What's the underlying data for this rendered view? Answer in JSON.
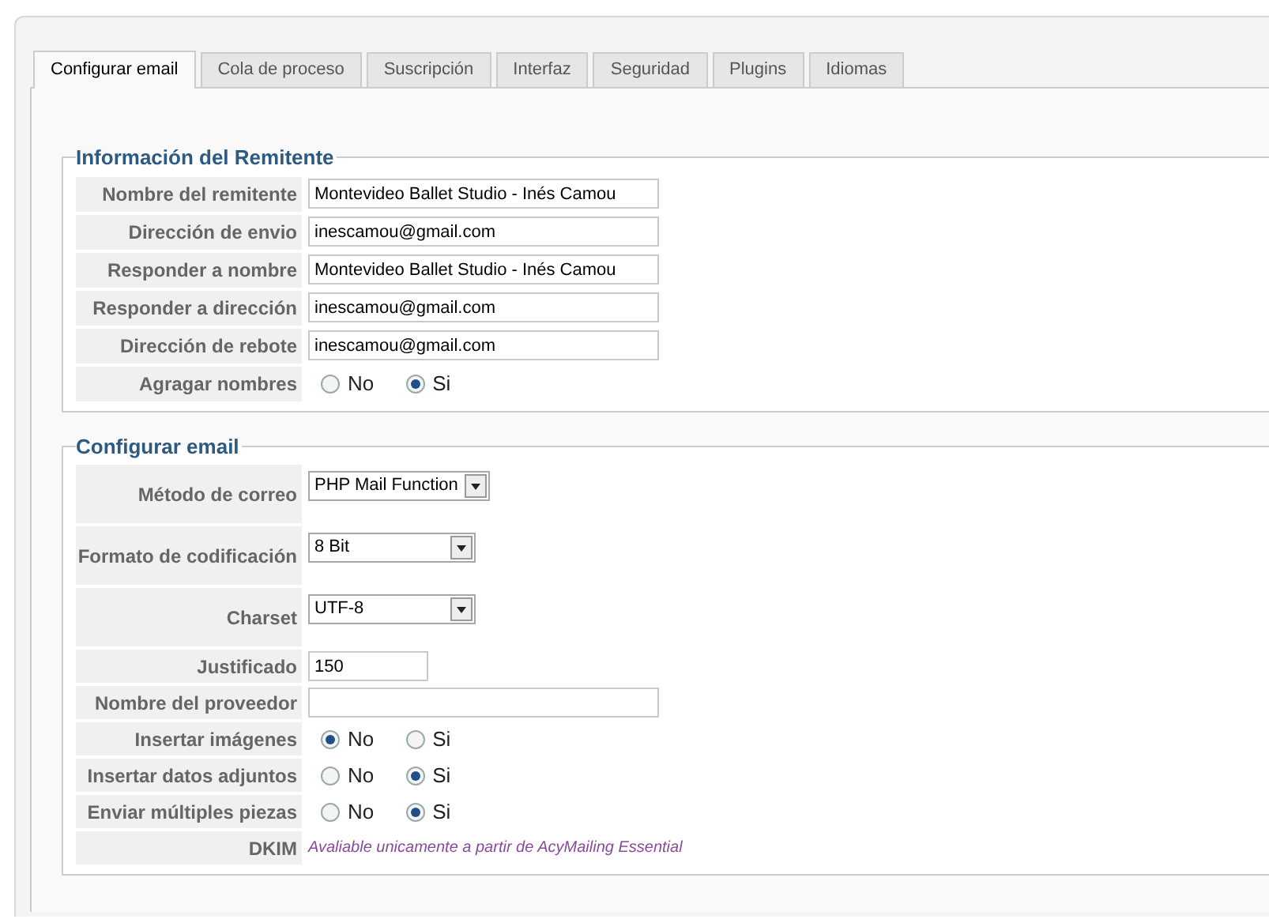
{
  "tabs": [
    {
      "label": "Configurar email",
      "selected": true
    },
    {
      "label": "Cola de proceso",
      "selected": false
    },
    {
      "label": "Suscripción",
      "selected": false
    },
    {
      "label": "Interfaz",
      "selected": false
    },
    {
      "label": "Seguridad",
      "selected": false
    },
    {
      "label": "Plugins",
      "selected": false
    },
    {
      "label": "Idiomas",
      "selected": false
    }
  ],
  "sections": [
    {
      "legend": "Información del Remitente",
      "rows": [
        {
          "kind": "text",
          "label": "Nombre del remitente",
          "value": "Montevideo Ballet Studio - Inés Camou"
        },
        {
          "kind": "text",
          "label": "Dirección de envio",
          "value": "inescamou@gmail.com"
        },
        {
          "kind": "text",
          "label": "Responder a nombre",
          "value": "Montevideo Ballet Studio - Inés Camou"
        },
        {
          "kind": "text",
          "label": "Responder a dirección",
          "value": "inescamou@gmail.com"
        },
        {
          "kind": "text",
          "label": "Dirección de rebote",
          "value": "inescamou@gmail.com"
        },
        {
          "kind": "radio",
          "label": "Agragar nombres",
          "options": [
            {
              "label": "No",
              "selected": false
            },
            {
              "label": "Si",
              "selected": true
            }
          ]
        }
      ]
    },
    {
      "legend": "Configurar email",
      "rows": [
        {
          "kind": "select",
          "label": "Método de correo",
          "value": "PHP Mail Function"
        },
        {
          "kind": "select",
          "label": "Formato de codificación",
          "value": "8 Bit"
        },
        {
          "kind": "select",
          "label": "Charset",
          "value": "UTF-8"
        },
        {
          "kind": "short",
          "label": "Justificado",
          "value": "150"
        },
        {
          "kind": "text",
          "label": "Nombre del proveedor",
          "value": ""
        },
        {
          "kind": "radio",
          "label": "Insertar imágenes",
          "options": [
            {
              "label": "No",
              "selected": true
            },
            {
              "label": "Si",
              "selected": false
            }
          ]
        },
        {
          "kind": "radio",
          "label": "Insertar datos adjuntos",
          "options": [
            {
              "label": "No",
              "selected": false
            },
            {
              "label": "Si",
              "selected": true
            }
          ]
        },
        {
          "kind": "radio",
          "label": "Enviar múltiples piezas",
          "options": [
            {
              "label": "No",
              "selected": false
            },
            {
              "label": "Si",
              "selected": true
            }
          ]
        },
        {
          "kind": "note",
          "label": "DKIM",
          "value": "Avaliable unicamente a partir de AcyMailing Essential"
        }
      ]
    }
  ]
}
